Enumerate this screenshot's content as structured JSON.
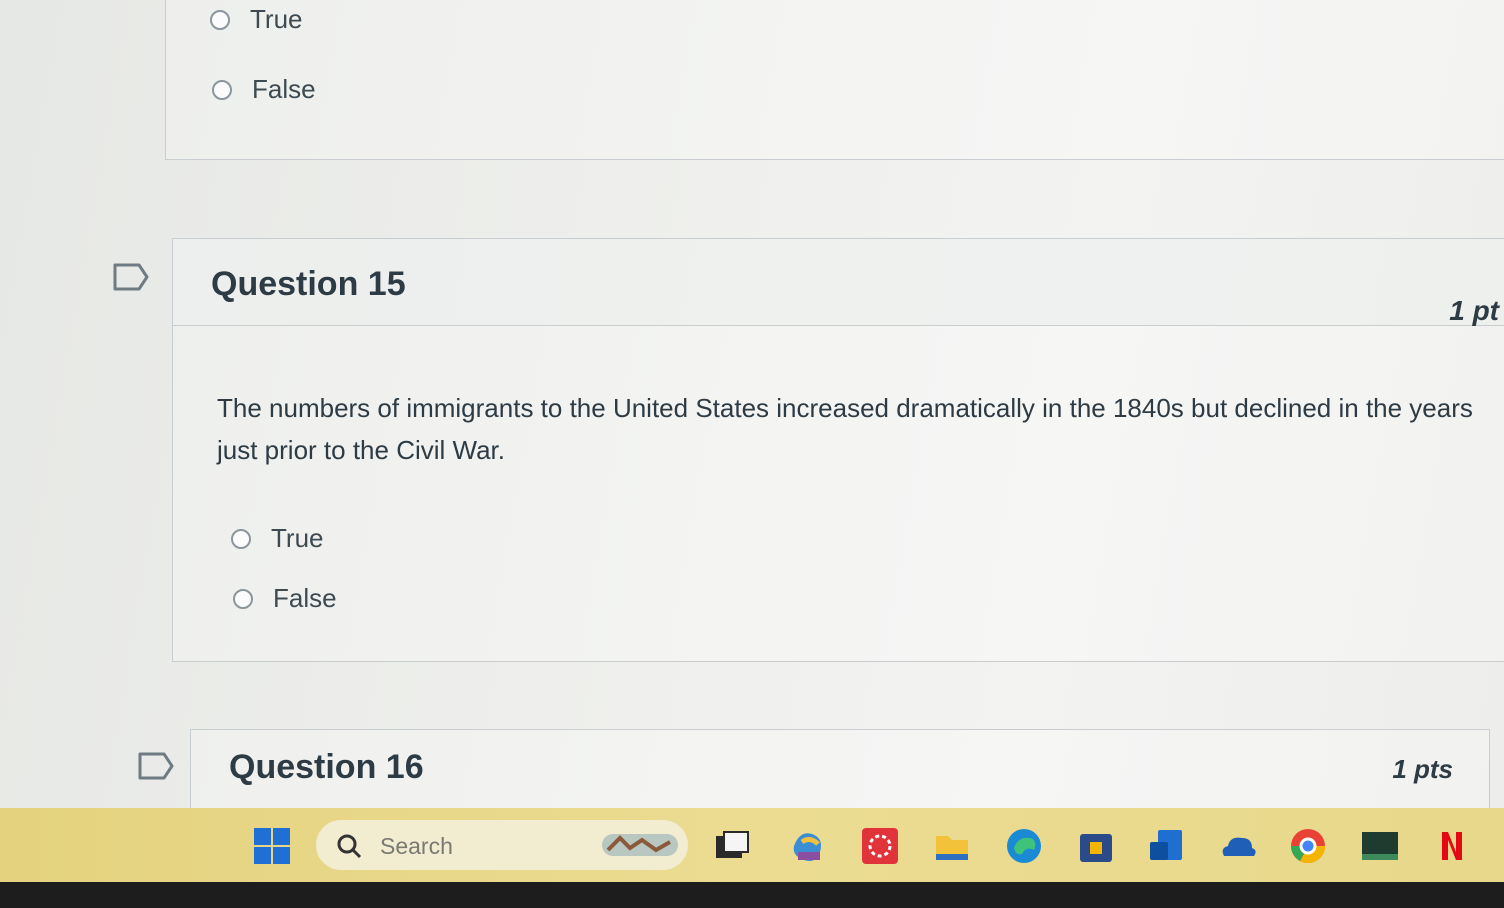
{
  "previous_question": {
    "options": [
      "True",
      "False"
    ]
  },
  "question15": {
    "title": "Question 15",
    "points": "1 pt",
    "text": "The numbers of immigrants to the United States increased dramatically in the 1840s but declined in the years just prior to the Civil War.",
    "options": [
      "True",
      "False"
    ]
  },
  "question16": {
    "title": "Question 16",
    "points": "1 pts"
  },
  "taskbar": {
    "search_placeholder": "Search",
    "icons": [
      "windows-start-icon",
      "search-icon",
      "widget-icon",
      "task-view-icon",
      "copilot-icon",
      "app-red-icon",
      "file-explorer-icon",
      "edge-icon",
      "store-icon",
      "outlook-icon",
      "onedrive-icon",
      "chrome-icon",
      "app-dark-icon",
      "netflix-icon"
    ]
  },
  "colors": {
    "text": "#2d3b45",
    "border": "#c7cdd1",
    "taskbar": "#e8d88a"
  }
}
